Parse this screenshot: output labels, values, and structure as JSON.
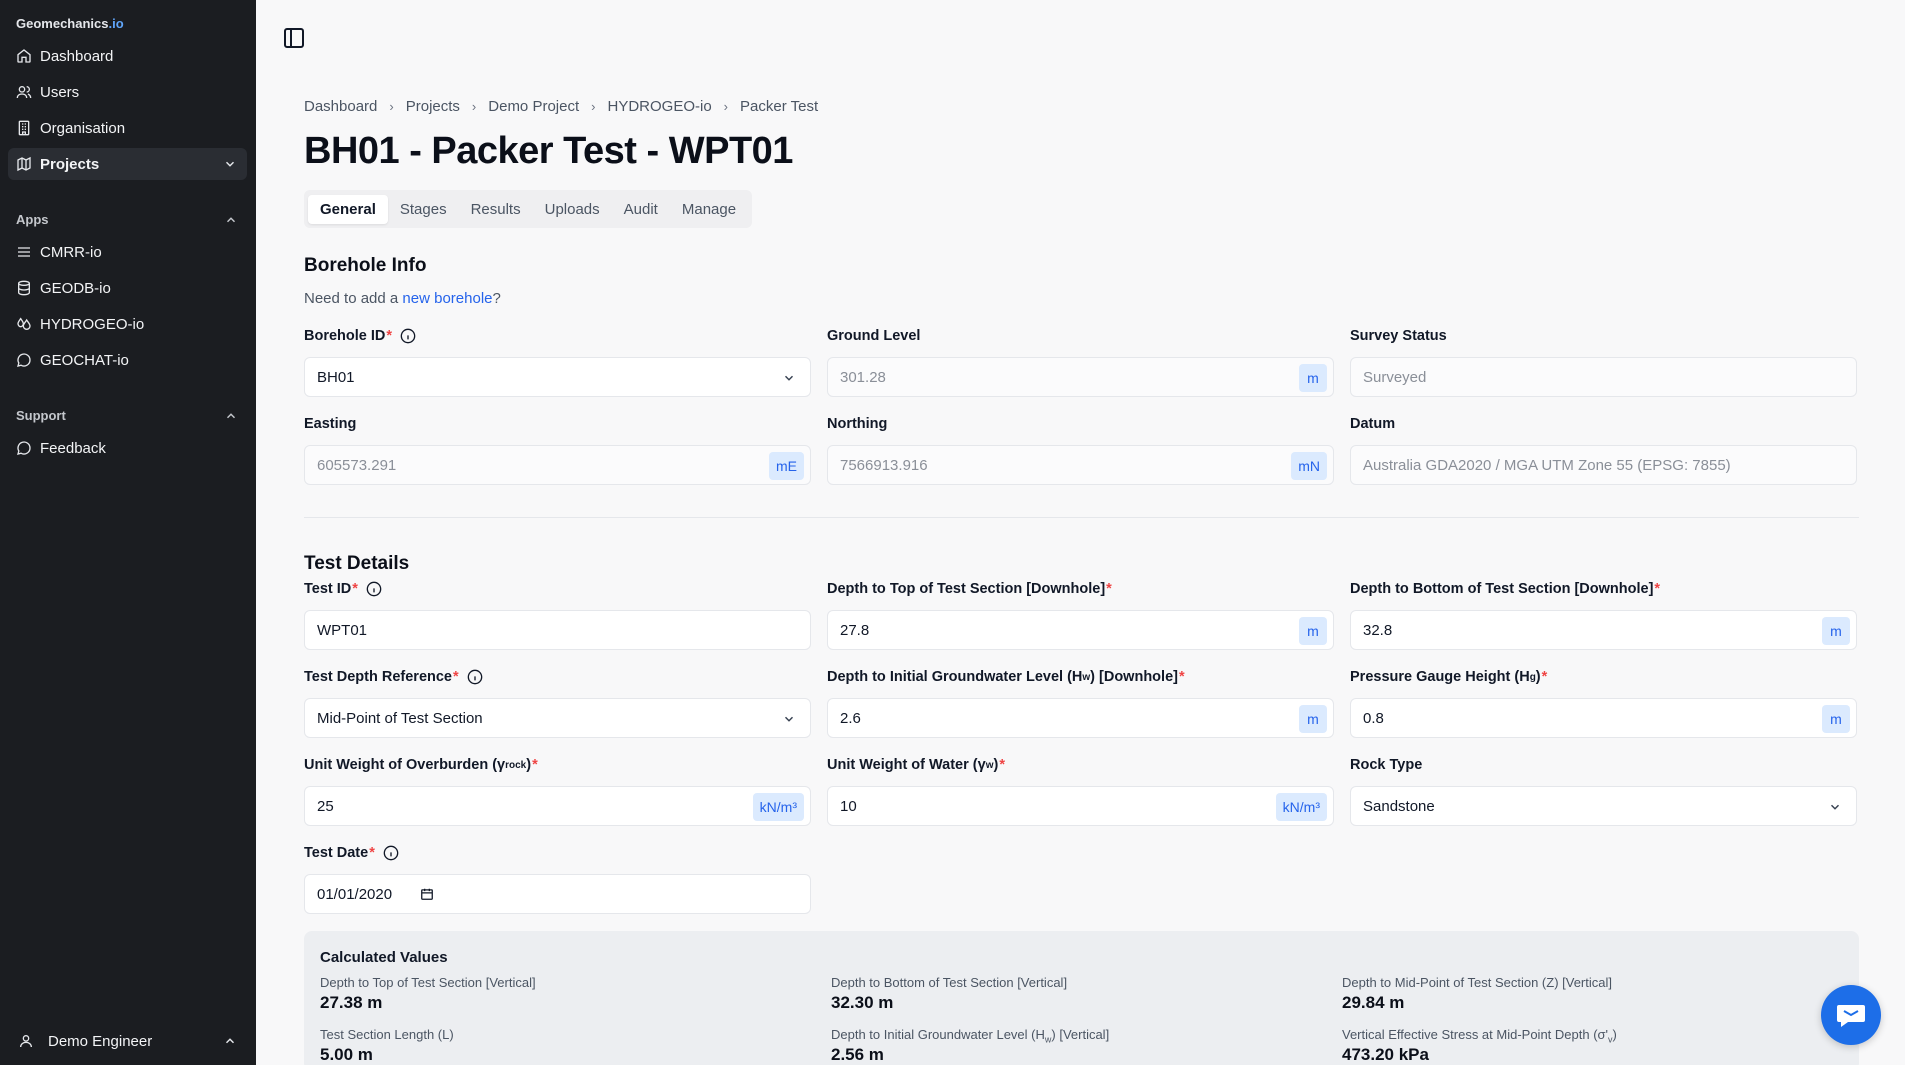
{
  "brand": {
    "name": "Geomechanics",
    "suffix": ".io"
  },
  "sidebar": {
    "main_items": [
      {
        "label": "Dashboard",
        "icon": "home-icon"
      },
      {
        "label": "Users",
        "icon": "users-icon"
      },
      {
        "label": "Organisation",
        "icon": "building-icon"
      },
      {
        "label": "Projects",
        "icon": "map-icon"
      }
    ],
    "apps_label": "Apps",
    "apps": [
      {
        "label": "CMRR-io",
        "icon": "menu-icon"
      },
      {
        "label": "GEODB-io",
        "icon": "database-icon"
      },
      {
        "label": "HYDROGEO-io",
        "icon": "droplet-icon"
      },
      {
        "label": "GEOCHAT-io",
        "icon": "chat-icon"
      }
    ],
    "support_label": "Support",
    "support": [
      {
        "label": "Feedback",
        "icon": "chat-icon"
      }
    ],
    "user": "Demo Engineer"
  },
  "breadcrumbs": [
    "Dashboard",
    "Projects",
    "Demo Project",
    "HYDROGEO-io",
    "Packer Test"
  ],
  "page_title": "BH01 - Packer Test - WPT01",
  "tabs": [
    "General",
    "Stages",
    "Results",
    "Uploads",
    "Audit",
    "Manage"
  ],
  "borehole": {
    "title": "Borehole Info",
    "hint_prefix": "Need to add a ",
    "hint_link": "new borehole",
    "hint_suffix": "?",
    "id_label": "Borehole ID",
    "id_value": "BH01",
    "ground_label": "Ground Level",
    "ground_value": "301.28",
    "ground_unit": "m",
    "survey_label": "Survey Status",
    "survey_value": "Surveyed",
    "easting_label": "Easting",
    "easting_value": "605573.291",
    "easting_unit": "mE",
    "northing_label": "Northing",
    "northing_value": "7566913.916",
    "northing_unit": "mN",
    "datum_label": "Datum",
    "datum_value": "Australia GDA2020 / MGA UTM Zone 55 (EPSG: 7855)"
  },
  "test": {
    "title": "Test Details",
    "test_id_label": "Test ID",
    "test_id_value": "WPT01",
    "top_label": "Depth to Top of Test Section [Downhole]",
    "top_value": "27.8",
    "top_unit": "m",
    "bottom_label": "Depth to Bottom of Test Section [Downhole]",
    "bottom_value": "32.8",
    "bottom_unit": "m",
    "ref_label": "Test Depth Reference",
    "ref_value": "Mid-Point of Test Section",
    "gw_label_a": "Depth to Initial Groundwater Level (H",
    "gw_label_sub": "w",
    "gw_label_b": ") [Downhole]",
    "gw_value": "2.6",
    "gw_unit": "m",
    "pg_label_a": "Pressure Gauge Height (H",
    "pg_label_sub": "g",
    "pg_label_b": ")",
    "pg_value": "0.8",
    "pg_unit": "m",
    "uwo_label_a": "Unit Weight of Overburden (γ",
    "uwo_label_sub": "rock",
    "uwo_label_b": ")",
    "uwo_value": "25",
    "uwo_unit": "kN/m³",
    "uww_label_a": "Unit Weight of Water (γ",
    "uww_label_sub": "w",
    "uww_label_b": ")",
    "uww_value": "10",
    "uww_unit": "kN/m³",
    "rock_label": "Rock Type",
    "rock_value": "Sandstone",
    "date_label": "Test Date",
    "date_value": "01/01/2020"
  },
  "calc": {
    "title": "Calculated Values",
    "top_label": "Depth to Top of Test Section [Vertical]",
    "top_value": "27.38 m",
    "bottom_label": "Depth to Bottom of Test Section [Vertical]",
    "bottom_value": "32.30 m",
    "mid_label": "Depth to Mid-Point of Test Section (Z) [Vertical]",
    "mid_value": "29.84 m",
    "len_label": "Test Section Length (L)",
    "len_value": "5.00 m",
    "gw_label_a": "Depth to Initial Groundwater Level (H",
    "gw_label_sub": "w",
    "gw_label_b": ") [Vertical]",
    "gw_value": "2.56 m",
    "ves_label_a": "Vertical Effective Stress at Mid-Point Depth (σ'",
    "ves_label_sub": "v",
    "ves_label_b": ")",
    "ves_value": "473.20 kPa"
  },
  "colors": {
    "accent": "#2563eb",
    "unit_bg": "#dbeafe",
    "sidebar_bg": "#1b1d21",
    "required": "#ef4444",
    "fab": "#1d6ee8"
  }
}
